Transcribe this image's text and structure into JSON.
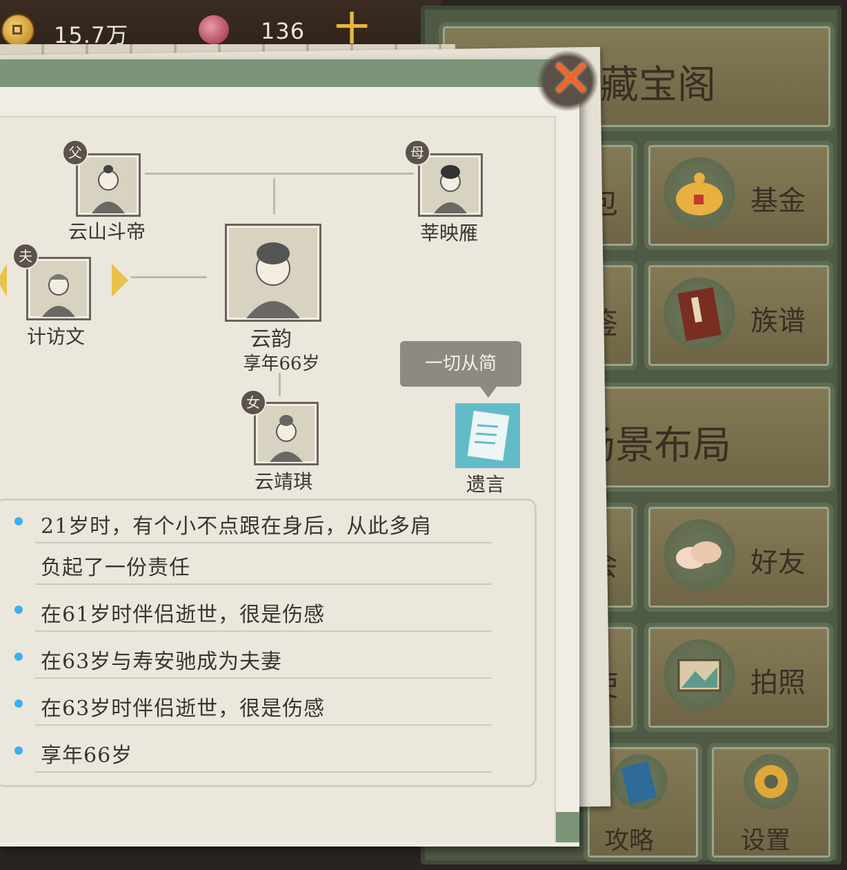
{
  "topbar": {
    "coins": "15.7万",
    "gems": "136",
    "plus_icon": "plus-icon",
    "coin_icon": "copper-coin-icon",
    "gem_icon": "peach-gem-icon"
  },
  "right_menu": {
    "treasure": "藏宝阁",
    "fund": "基金",
    "genealogy": "族谱",
    "scene_layout": "场景布局",
    "friends": "好友",
    "photo": "拍照",
    "guide": "攻略",
    "settings": "设置",
    "partial_left": [
      "包",
      "鉴",
      "会",
      "使"
    ]
  },
  "family": {
    "father": {
      "badge": "父",
      "name": "云山斗帝"
    },
    "mother": {
      "badge": "母",
      "name": "莘映雁"
    },
    "husband": {
      "badge": "夫",
      "name": "计访文"
    },
    "self": {
      "name": "云韵",
      "age": "享年66岁"
    },
    "daughter": {
      "badge": "女",
      "name": "云靖琪"
    }
  },
  "will": {
    "tooltip": "一切从简",
    "label": "遗言"
  },
  "events": [
    {
      "line1": "21岁时，有个小不点跟在身后，从此多肩",
      "line2": "负起了一份责任"
    },
    {
      "line1": "在61岁时伴侣逝世，很是伤感"
    },
    {
      "line1": "在63岁与寿安驰成为夫妻"
    },
    {
      "line1": "在63岁时伴侣逝世，很是伤感"
    },
    {
      "line1": "享年66岁"
    }
  ],
  "colors": {
    "accent_green": "#7c9478",
    "close_orange": "#f2652b",
    "bullet_blue": "#3ab0f2",
    "will_teal": "#62bcc8"
  }
}
